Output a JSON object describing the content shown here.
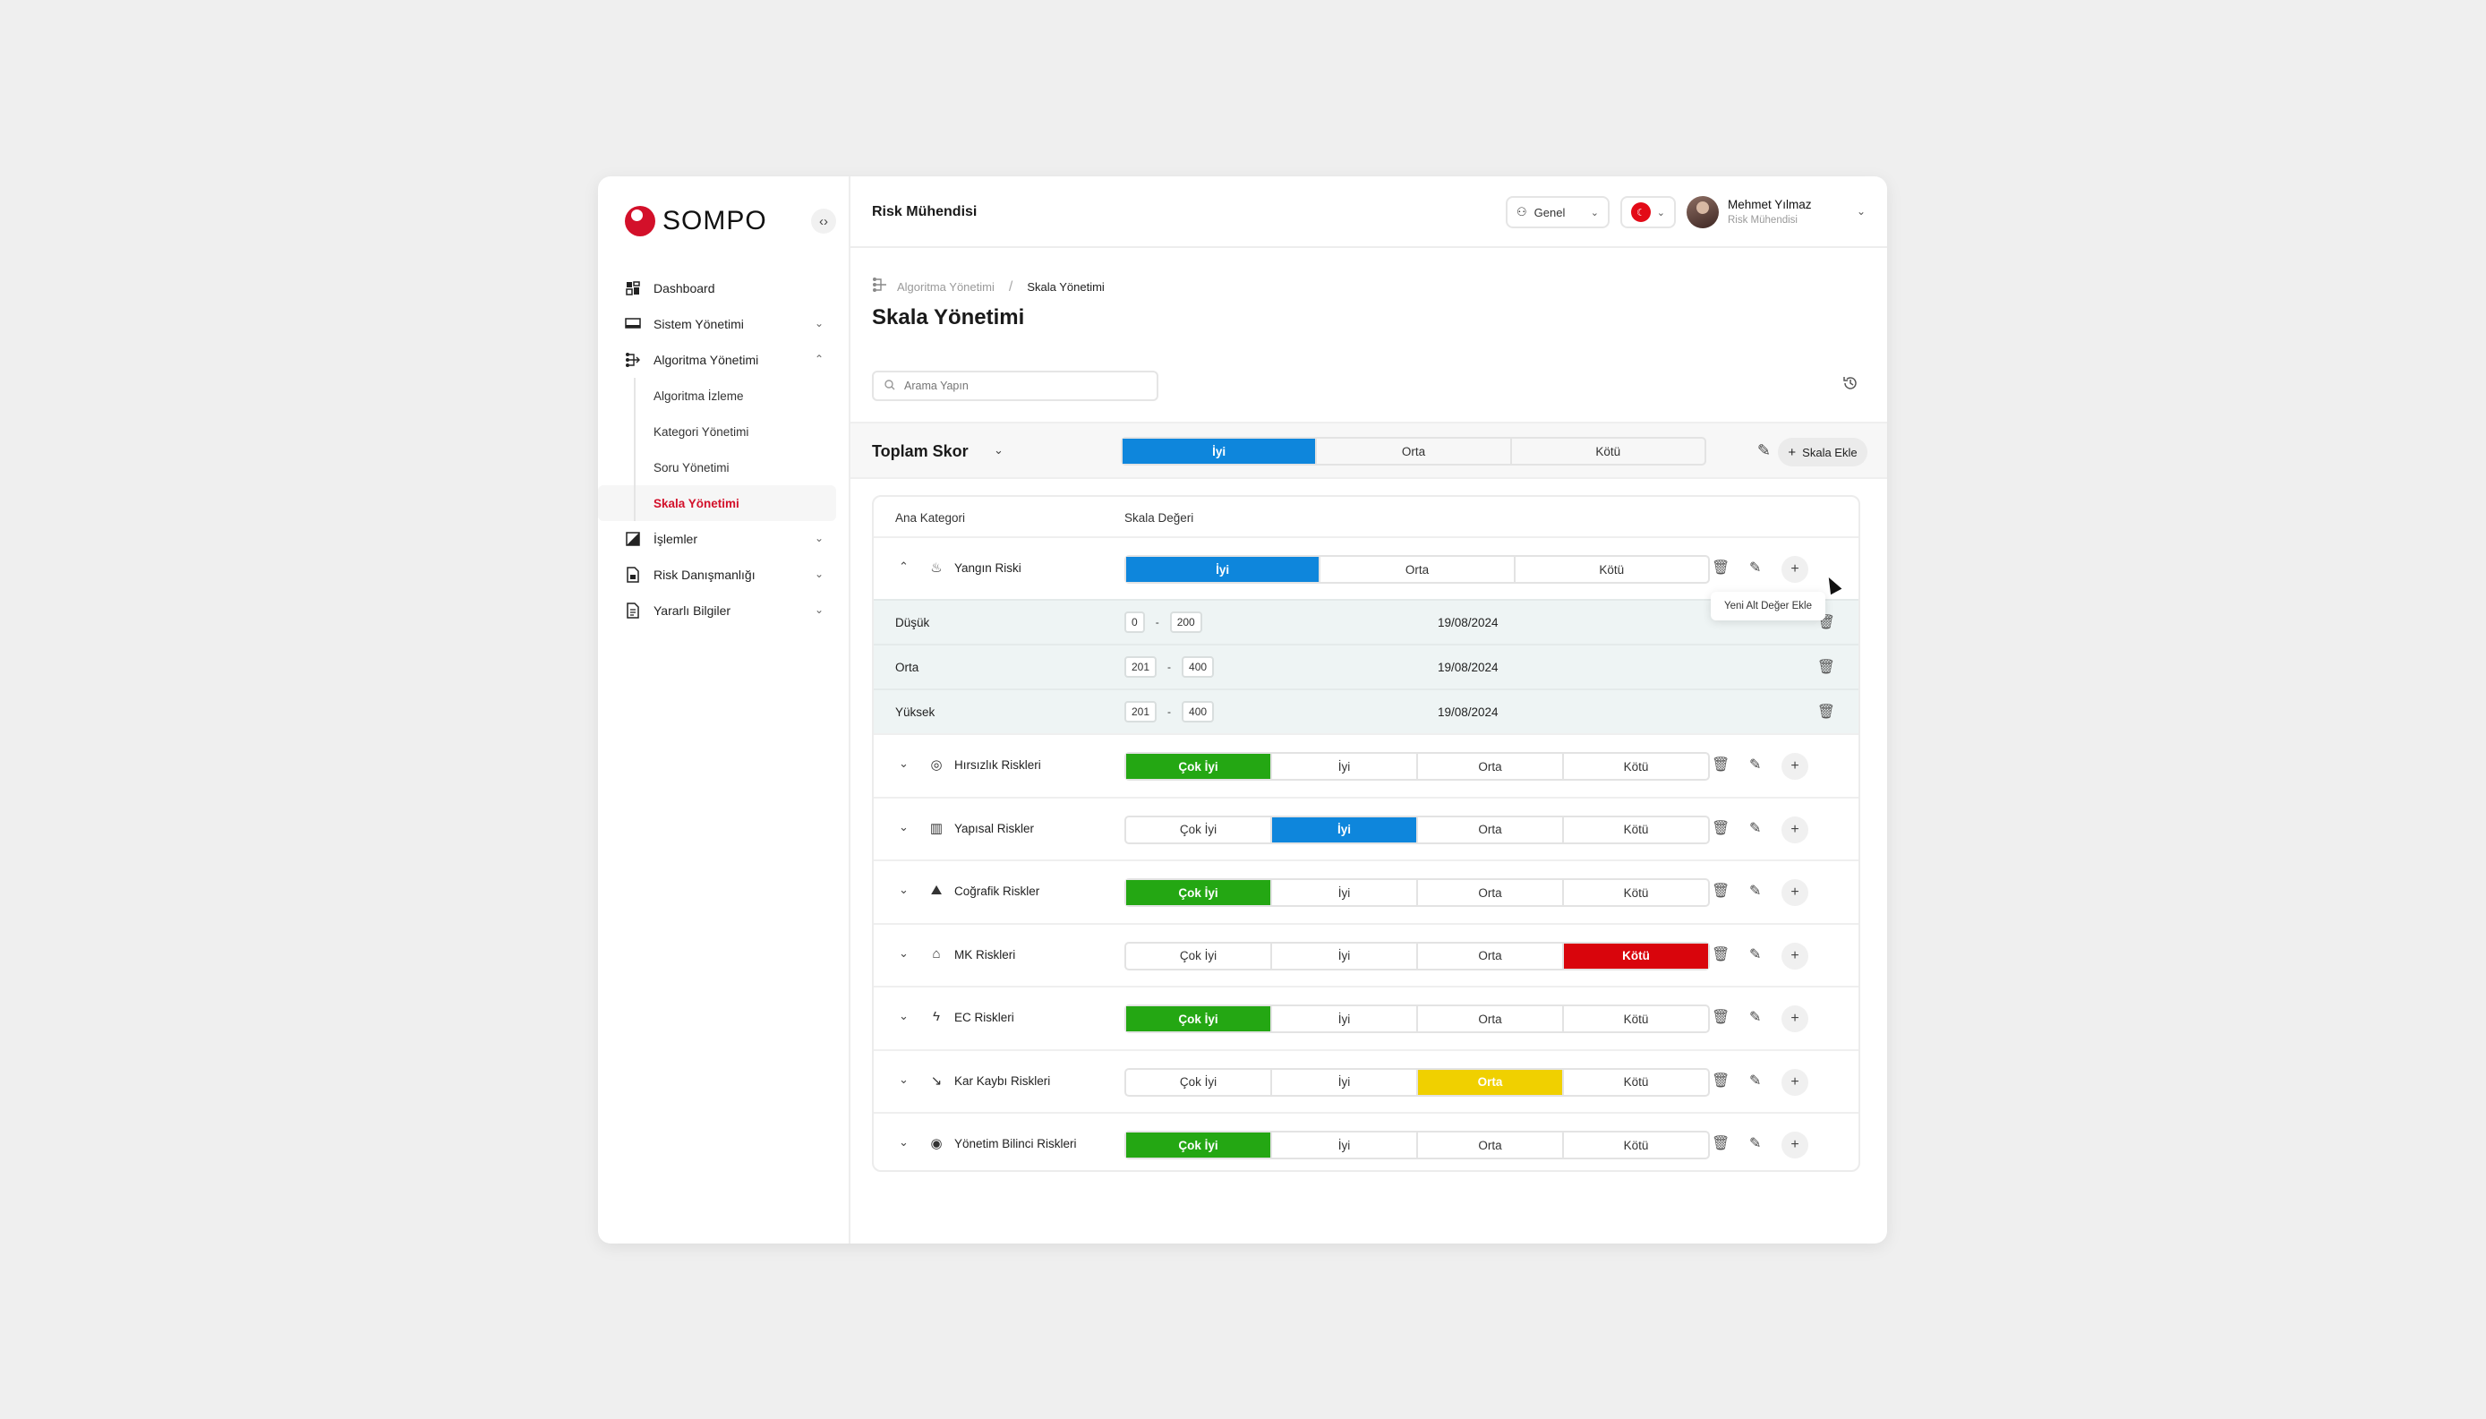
{
  "sidebar": {
    "logo_text": "SOMPO",
    "collapse_icon": "‹›",
    "items": [
      {
        "label": "Dashboard",
        "icon": "dashboard-icon"
      },
      {
        "label": "Sistem Yönetimi",
        "icon": "monitor-icon"
      },
      {
        "label": "Algoritma Yönetimi",
        "icon": "algorithm-icon"
      },
      {
        "label": "İşlemler",
        "icon": "chart-icon"
      },
      {
        "label": "Risk Danışmanlığı",
        "icon": "document-icon"
      },
      {
        "label": "Yararlı Bilgiler",
        "icon": "info-document-icon"
      }
    ],
    "sub_items": [
      {
        "label": "Algoritma İzleme"
      },
      {
        "label": "Kategori Yönetimi"
      },
      {
        "label": "Soru Yönetimi"
      },
      {
        "label": "Skala Yönetimi"
      }
    ]
  },
  "header": {
    "page_role": "Risk Mühendisi",
    "mode_label": "Genel",
    "user_name": "Mehmet Yılmaz",
    "user_role": "Risk Mühendisi"
  },
  "main": {
    "breadcrumb": [
      "Algoritma Yönetimi",
      "Skala Yönetimi"
    ],
    "title": "Skala Yönetimi",
    "search_placeholder": "Arama Yapın",
    "total": {
      "title": "Toplam Skor",
      "options": [
        "İyi",
        "Orta",
        "Kötü"
      ],
      "add_scale_label": "Skala Ekle"
    },
    "table": {
      "col_category": "Ana Kategori",
      "col_scale": "Skala Değeri",
      "tooltip": "Yeni Alt Değer Ekle",
      "expanded": {
        "label": "Yangın Riski",
        "options": [
          "İyi",
          "Orta",
          "Kötü"
        ],
        "sub_rows": [
          {
            "label": "Düşük",
            "min": "0",
            "max": "200",
            "date": "19/08/2024"
          },
          {
            "label": "Orta",
            "min": "201",
            "max": "400",
            "date": "19/08/2024"
          },
          {
            "label": "Yüksek",
            "min": "201",
            "max": "400",
            "date": "19/08/2024"
          }
        ]
      },
      "rows": [
        {
          "label": "Hırsızlık Riskleri",
          "icon": "thief-mask-icon",
          "options": [
            "Çok İyi",
            "İyi",
            "Orta",
            "Kötü"
          ],
          "selected": 0,
          "color": "#24a713"
        },
        {
          "label": "Yapısal Riskler",
          "icon": "building-icon",
          "options": [
            "Çok İyi",
            "İyi",
            "Orta",
            "Kötü"
          ],
          "selected": 1,
          "color": "#0e86dc"
        },
        {
          "label": "Coğrafik Riskler",
          "icon": "mountain-icon",
          "options": [
            "Çok İyi",
            "İyi",
            "Orta",
            "Kötü"
          ],
          "selected": 0,
          "color": "#24a713"
        },
        {
          "label": "MK Riskleri",
          "icon": "house-damage-icon",
          "options": [
            "Çok İyi",
            "İyi",
            "Orta",
            "Kötü"
          ],
          "selected": 3,
          "color": "#d9050c"
        },
        {
          "label": "EC Riskleri",
          "icon": "lightning-icon",
          "options": [
            "Çok İyi",
            "İyi",
            "Orta",
            "Kötü"
          ],
          "selected": 0,
          "color": "#24a713"
        },
        {
          "label": "Kar Kaybı Riskleri",
          "icon": "trend-down-icon",
          "options": [
            "Çok İyi",
            "İyi",
            "Orta",
            "Kötü"
          ],
          "selected": 2,
          "color": "#f0d000"
        },
        {
          "label": "Yönetim Bilinci Riskleri",
          "icon": "target-icon",
          "options": [
            "Çok İyi",
            "İyi",
            "Orta",
            "Kötü"
          ],
          "selected": 0,
          "color": "#24a713"
        }
      ]
    }
  },
  "colors": {
    "brand": "#d3102a",
    "good_blue": "#0e86dc",
    "great_green": "#24a713",
    "bad_red": "#d9050c",
    "mid_yellow": "#f0d000"
  }
}
